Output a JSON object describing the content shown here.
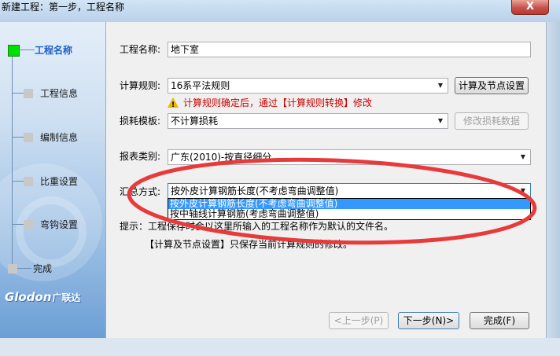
{
  "window": {
    "title": "新建工程：第一步，工程名称",
    "close_label": "X"
  },
  "sidebar": {
    "steps": [
      {
        "label": "工程名称",
        "active": true
      },
      {
        "label": "工程信息"
      },
      {
        "label": "编制信息"
      },
      {
        "label": "比重设置"
      },
      {
        "label": "弯钩设置"
      },
      {
        "label": "完成"
      }
    ],
    "logo_text": "Glodon",
    "logo_cn": "广联达"
  },
  "form": {
    "project_name_label": "工程名称:",
    "project_name_value": "地下室",
    "calc_rule_label": "计算规则:",
    "calc_rule_value": "16系平法规则",
    "calc_node_button": "计算及节点设置",
    "warning_text": "计算规则确定后，通过【计算规则转换】修改",
    "loss_template_label": "损耗模板:",
    "loss_template_value": "不计算损耗",
    "modify_loss_button": "修改损耗数据",
    "report_type_label": "报表类别:",
    "report_type_value": "广东(2010)-按直径细分",
    "summary_label": "汇总方式:",
    "summary_value": "按外皮计算钢筋长度(不考虑弯曲调整值)",
    "summary_options": [
      "按外皮计算钢筋长度(不考虑弯曲调整值)",
      "按中轴线计算钢筋(考虑弯曲调整值)"
    ],
    "hint_line1": "提示：工程保存时会以这里所输入的工程名称作为默认的文件名。",
    "hint_line2": "【计算及节点设置】只保存当前计算规则的修改。"
  },
  "footer": {
    "prev_button": "<上一步(P)",
    "next_button": "下一步(N)>",
    "finish_button": "完成(F)"
  },
  "colors": {
    "active_step": "#1f5fc2",
    "active_marker": "#00e000",
    "warning_text": "#cc0000",
    "selection": "#3399ff",
    "annotation_ellipse": "#e83a3a"
  }
}
